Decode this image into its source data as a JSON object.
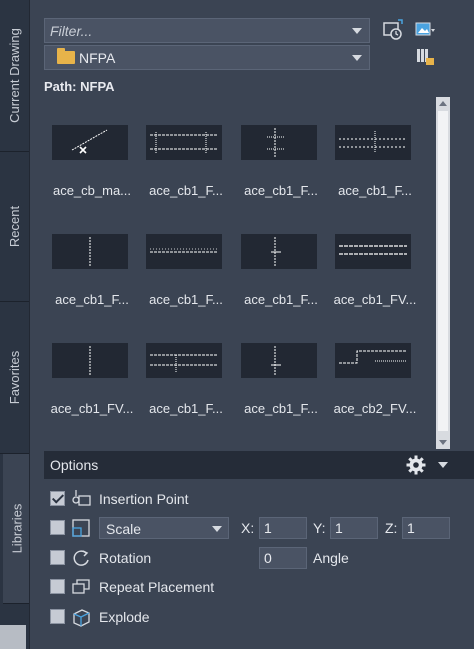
{
  "tabs": [
    {
      "label": "Current Drawing",
      "active": false
    },
    {
      "label": "Recent",
      "active": false
    },
    {
      "label": "Favorites",
      "active": false
    },
    {
      "label": "Libraries",
      "active": true
    }
  ],
  "filter": {
    "placeholder": "Filter..."
  },
  "folder": {
    "name": "NFPA",
    "icon": "folder-icon"
  },
  "path": {
    "label": "Path: NFPA"
  },
  "toolbar_icons": [
    "load-block-icon",
    "view-options-icon",
    "library-browse-icon"
  ],
  "blocks": [
    {
      "label": "ace_cb_ma..."
    },
    {
      "label": "ace_cb1_F..."
    },
    {
      "label": "ace_cb1_F..."
    },
    {
      "label": "ace_cb1_F..."
    },
    {
      "label": "ace_cb1_F..."
    },
    {
      "label": "ace_cb1_F..."
    },
    {
      "label": "ace_cb1_F..."
    },
    {
      "label": "ace_cb1_FV..."
    },
    {
      "label": "ace_cb1_FV..."
    },
    {
      "label": "ace_cb1_F..."
    },
    {
      "label": "ace_cb1_F..."
    },
    {
      "label": "ace_cb2_FV..."
    }
  ],
  "options": {
    "title": "Options",
    "insertion_point": {
      "label": "Insertion Point",
      "checked": true
    },
    "scale": {
      "mode": "Scale",
      "checked": false,
      "x_label": "X:",
      "x": "1",
      "y_label": "Y:",
      "y": "1",
      "z_label": "Z:",
      "z": "1"
    },
    "rotation": {
      "label": "Rotation",
      "checked": false,
      "value": "0",
      "unit_label": "Angle"
    },
    "repeat_placement": {
      "label": "Repeat Placement",
      "checked": false
    },
    "explode": {
      "label": "Explode",
      "checked": false
    }
  },
  "colors": {
    "panel": "#3b4453",
    "background": "#232a36",
    "folder": "#e7b34a",
    "accent_blue": "#4aa3e0"
  }
}
